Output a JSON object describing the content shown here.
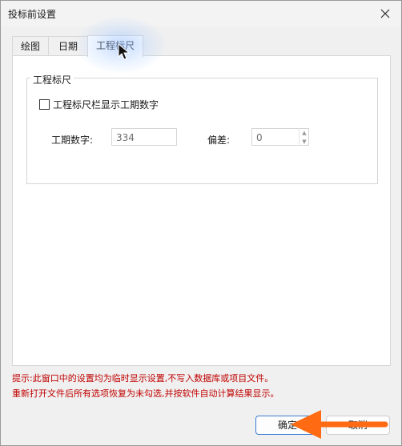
{
  "window": {
    "title": "投标前设置"
  },
  "tabs": [
    {
      "label": "绘图"
    },
    {
      "label": "日期"
    },
    {
      "label": "工程标尺"
    }
  ],
  "group": {
    "title": "工程标尺",
    "checkbox_label": "工程标尺栏显示工期数字",
    "checkbox_checked": false,
    "period_label": "工期数字:",
    "period_value": "334",
    "offset_label": "偏差:",
    "offset_value": "0"
  },
  "hint": {
    "line1": "提示:此窗口中的设置均为临时显示设置,不写入数据库或项目文件。",
    "line2": "重新打开文件后所有选项恢复为未勾选,并按软件自动计算结果显示。"
  },
  "buttons": {
    "ok": "确定",
    "cancel": "取消"
  },
  "icons": {
    "close": "close-icon",
    "cursor": "mouse-pointer-icon",
    "arrow": "annotation-arrow-icon"
  },
  "colors": {
    "hint": "#c00000",
    "arrow": "#ff6a13",
    "accent": "#3b7bd2"
  }
}
